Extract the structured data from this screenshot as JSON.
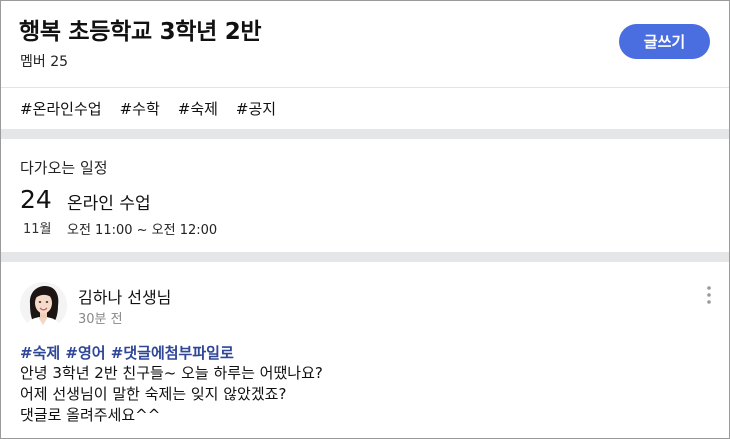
{
  "header": {
    "title": "행복 초등학교 3학년 2반",
    "member_count": "멤버 25",
    "write_button": "글쓰기"
  },
  "hashtags": [
    "#온라인수업",
    "#수학",
    "#숙제",
    "#공지"
  ],
  "schedule": {
    "heading": "다가오는 일정",
    "day": "24",
    "month": "11월",
    "event_title": "온라인 수업",
    "event_time": "오전 11:00 ~ 오전 12:00"
  },
  "post": {
    "author": "김하나 선생님",
    "time_ago": "30분 전",
    "tags": "#숙제 #영어 #댓글에첨부파일로",
    "lines": [
      "안녕 3학년 2반 친구들~ 오늘 하루는 어땠나요?",
      "어제 선생님이 말한 숙제는 잊지 않았겠죠?",
      "댓글로 올려주세요^^"
    ]
  },
  "colors": {
    "accent": "#4a6ee0",
    "hashtag_link": "#2f4699",
    "divider": "#e5e6e8"
  },
  "icons": {
    "more": "more-vertical-icon",
    "avatar": "teacher-avatar"
  }
}
